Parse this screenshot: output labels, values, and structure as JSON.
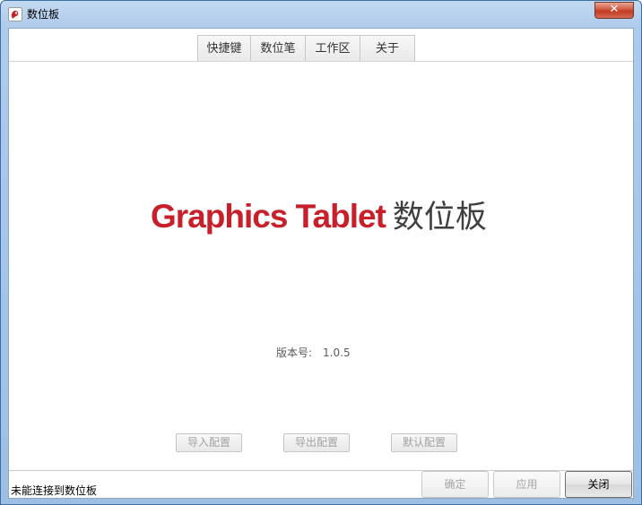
{
  "window": {
    "title": "数位板",
    "close_label": "✕"
  },
  "icons": {
    "app": "app-icon",
    "close": "close-icon"
  },
  "tabs": [
    {
      "label": "快捷键"
    },
    {
      "label": "数位笔"
    },
    {
      "label": "工作区"
    },
    {
      "label": "关于"
    }
  ],
  "about": {
    "brand_en": "Graphics Tablet",
    "brand_cn": "数位板",
    "version_label": "版本号:",
    "version_value": "1.0.5",
    "brand_color": "#c8202b"
  },
  "config_buttons": {
    "import_label": "导入配置",
    "export_label": "导出配置",
    "default_label": "默认配置"
  },
  "status": {
    "text": "未能连接到数位板"
  },
  "dialog_buttons": {
    "ok_label": "确定",
    "apply_label": "应用",
    "close_label": "关闭"
  }
}
